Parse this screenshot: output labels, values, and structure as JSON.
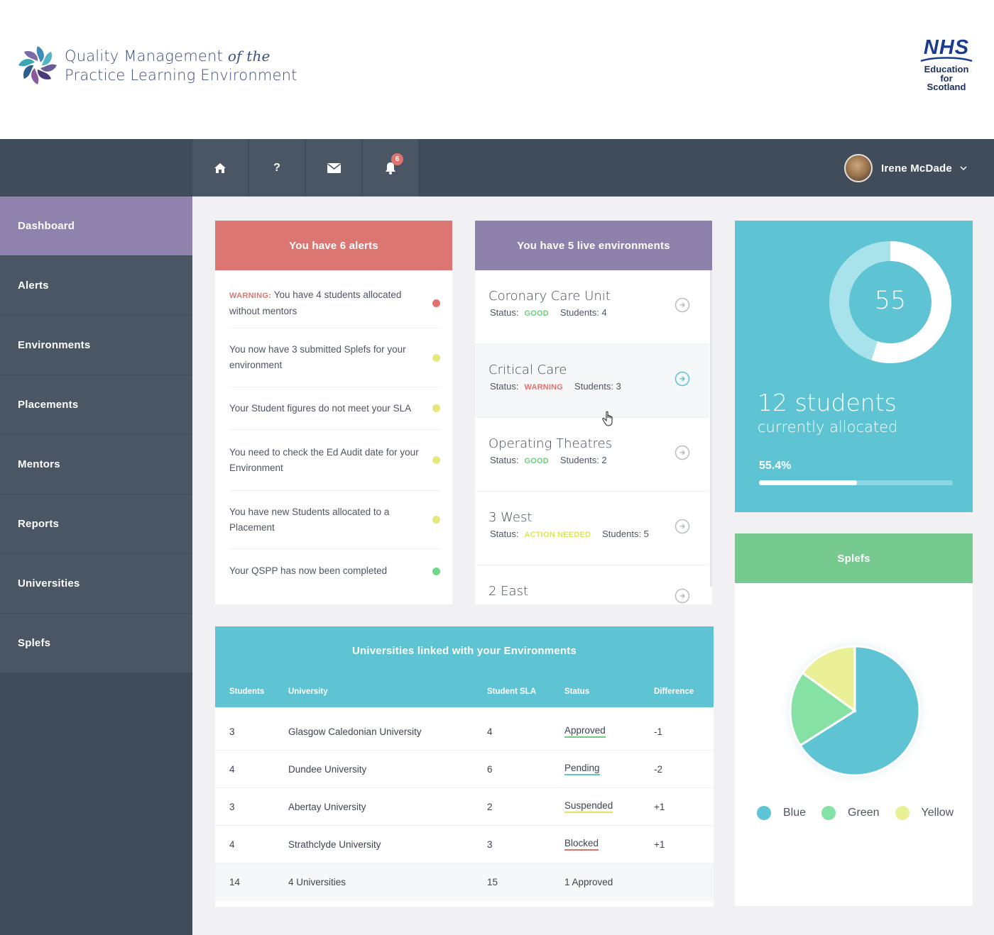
{
  "header": {
    "title_main": "Quality Management",
    "title_of_the": "of the",
    "title_line2": "Practice Learning Environment",
    "nhs_logo_text": "NHS",
    "nhs_sub_lines": [
      "Education",
      "for",
      "Scotland"
    ]
  },
  "topbar": {
    "icons": [
      "home-icon",
      "help-icon",
      "mail-icon",
      "bell-icon"
    ],
    "help_label": "?",
    "notification_count": "6",
    "user_name": "Irene McDade"
  },
  "sidebar": {
    "items": [
      {
        "label": "Dashboard",
        "active": true
      },
      {
        "label": "Alerts"
      },
      {
        "label": "Environments"
      },
      {
        "label": "Placements"
      },
      {
        "label": "Mentors"
      },
      {
        "label": "Reports"
      },
      {
        "label": "Universities"
      },
      {
        "label": "Splefs"
      }
    ]
  },
  "alerts": {
    "title": "You have 6 alerts",
    "items": [
      {
        "prefix": "WARNING:",
        "text": "You have 4 students allocated without mentors",
        "color": "#e0736e"
      },
      {
        "prefix": "",
        "text": "You now have 3 submitted Splefs for your environment",
        "color": "#e4e77a"
      },
      {
        "prefix": "",
        "text": "Your Student figures do not meet your SLA",
        "color": "#e4e77a"
      },
      {
        "prefix": "",
        "text": "You need to check the Ed Audit date for your Environment",
        "color": "#e4e77a"
      },
      {
        "prefix": "",
        "text": "You have new Students allocated to a Placement",
        "color": "#e4e77a"
      },
      {
        "prefix": "",
        "text": "Your QSPP has now been completed",
        "color": "#6fd88a"
      }
    ]
  },
  "environments": {
    "title": "You have 5 live environments",
    "status_label": "Status:",
    "items": [
      {
        "name": "Coronary Care Unit",
        "status": "GOOD",
        "status_color": "#6fce7c",
        "students": "Students: 4"
      },
      {
        "name": "Critical Care",
        "status": "WARNING",
        "status_color": "#e0736e",
        "students": "Students: 3"
      },
      {
        "name": "Operating Theatres",
        "status": "GOOD",
        "status_color": "#6fce7c",
        "students": "Students: 2"
      },
      {
        "name": "3 West",
        "status": "ACTION NEEDED",
        "status_color": "#dde55a",
        "students": "Students: 5"
      },
      {
        "name": "2 East",
        "status": "",
        "status_color": "#6fce7c",
        "students": ""
      }
    ]
  },
  "students": {
    "donut_value": "55",
    "donut_fraction": 0.55,
    "count_text": "12 students",
    "sub_text": "currently allocated",
    "percent_text": "55.4%",
    "percent_value": 0.505
  },
  "splefs": {
    "title": "Splefs",
    "legend": [
      {
        "label": "Blue",
        "color": "#5ec3d2"
      },
      {
        "label": "Green",
        "color": "#86e2a4"
      },
      {
        "label": "Yellow",
        "color": "#e9f096"
      }
    ],
    "slices": [
      {
        "label": "Blue",
        "value": 0.66,
        "color": "#5ec3d2"
      },
      {
        "label": "Green",
        "value": 0.19,
        "color": "#86e2a4"
      },
      {
        "label": "Yellow",
        "value": 0.15,
        "color": "#e9f096"
      }
    ]
  },
  "universities": {
    "title": "Universities linked with your Environments",
    "columns": [
      "Students",
      "University",
      "Student SLA",
      "Status",
      "Difference"
    ],
    "rows": [
      {
        "students": "3",
        "university": "Glasgow Caledonian University",
        "sla": "4",
        "status": "Approved",
        "status_color": "#6fce7c",
        "difference": "-1"
      },
      {
        "students": "4",
        "university": "Dundee University",
        "sla": "6",
        "status": "Pending",
        "status_color": "#5ec3d2",
        "difference": "-2"
      },
      {
        "students": "3",
        "university": "Abertay University",
        "sla": "2",
        "status": "Suspended",
        "status_color": "#dde55a",
        "difference": "+1"
      },
      {
        "students": "4",
        "university": "Strathclyde University",
        "sla": "3",
        "status": "Blocked",
        "status_color": "#e0736e",
        "difference": "+1"
      }
    ],
    "total": {
      "students": "14",
      "university": "4 Universities",
      "sla": "15",
      "status": "1 Approved",
      "difference": ""
    }
  }
}
